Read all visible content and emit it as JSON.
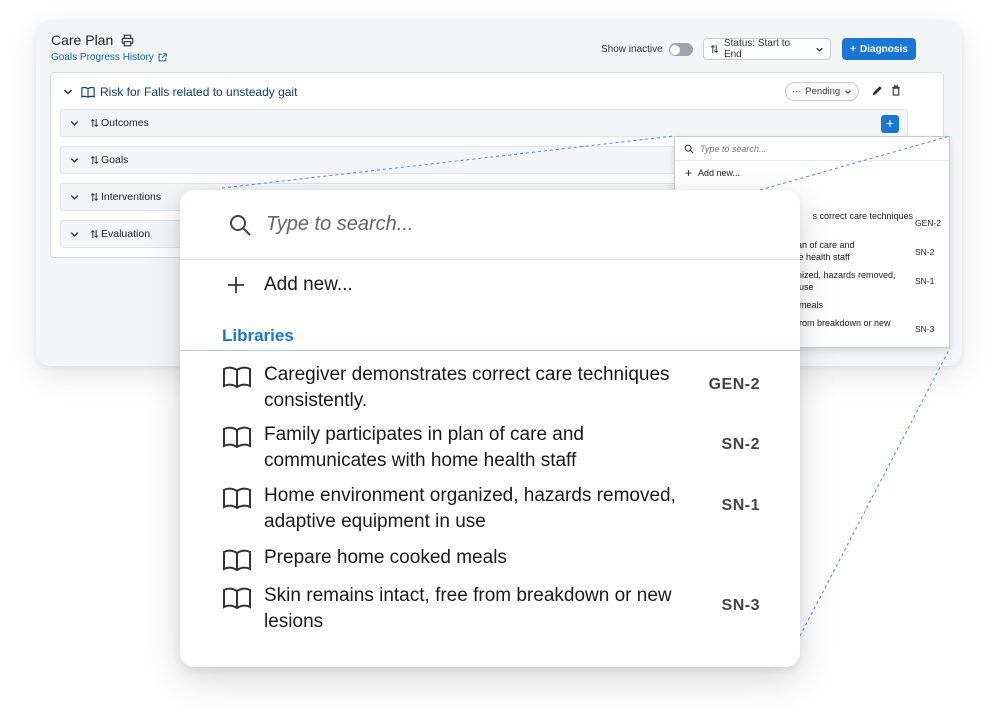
{
  "header": {
    "title": "Care Plan",
    "history_link": "Goals Progress History",
    "show_inactive_label": "Show inactive",
    "status_select": "Status: Start to End",
    "diagnosis_button": "Diagnosis"
  },
  "diagnosis": {
    "title": "Risk for Falls related to unsteady gait",
    "status": "Pending"
  },
  "sections": [
    {
      "label": "Outcomes"
    },
    {
      "label": "Goals"
    },
    {
      "label": "Interventions"
    },
    {
      "label": "Evaluation"
    }
  ],
  "dropdown": {
    "search_placeholder": "Type to search...",
    "add_new_label": "Add new...",
    "libraries_label": "Libraries",
    "items": [
      {
        "text": "Caregiver demonstrates correct care techniques consistently.",
        "code": "GEN-2"
      },
      {
        "text": "Family participates in plan of care and communicates with home health staff",
        "code": "SN-2"
      },
      {
        "text": "Home environment organized, hazards removed, adaptive equipment in use",
        "code": "SN-1"
      },
      {
        "text": "Prepare home cooked meals",
        "code": ""
      },
      {
        "text": "Skin remains intact, free from breakdown or new lesions",
        "code": "SN-3"
      }
    ]
  },
  "small_dropdown": {
    "items": [
      {
        "line1": "s correct care techniques",
        "line2": "",
        "code": "GEN-2"
      },
      {
        "line1": "lan of care and",
        "line2": "me health staff",
        "code": "SN-2"
      },
      {
        "line1": "ganized, hazards removed,",
        "line2": "use",
        "code": "SN-1"
      },
      {
        "line1": "meals",
        "line2": "",
        "code": ""
      },
      {
        "line1": "e from breakdown or new",
        "line2": "",
        "code": "SN-3"
      }
    ]
  },
  "colors": {
    "accent": "#1976d2",
    "diagnosis_title": "#0d3f73"
  }
}
